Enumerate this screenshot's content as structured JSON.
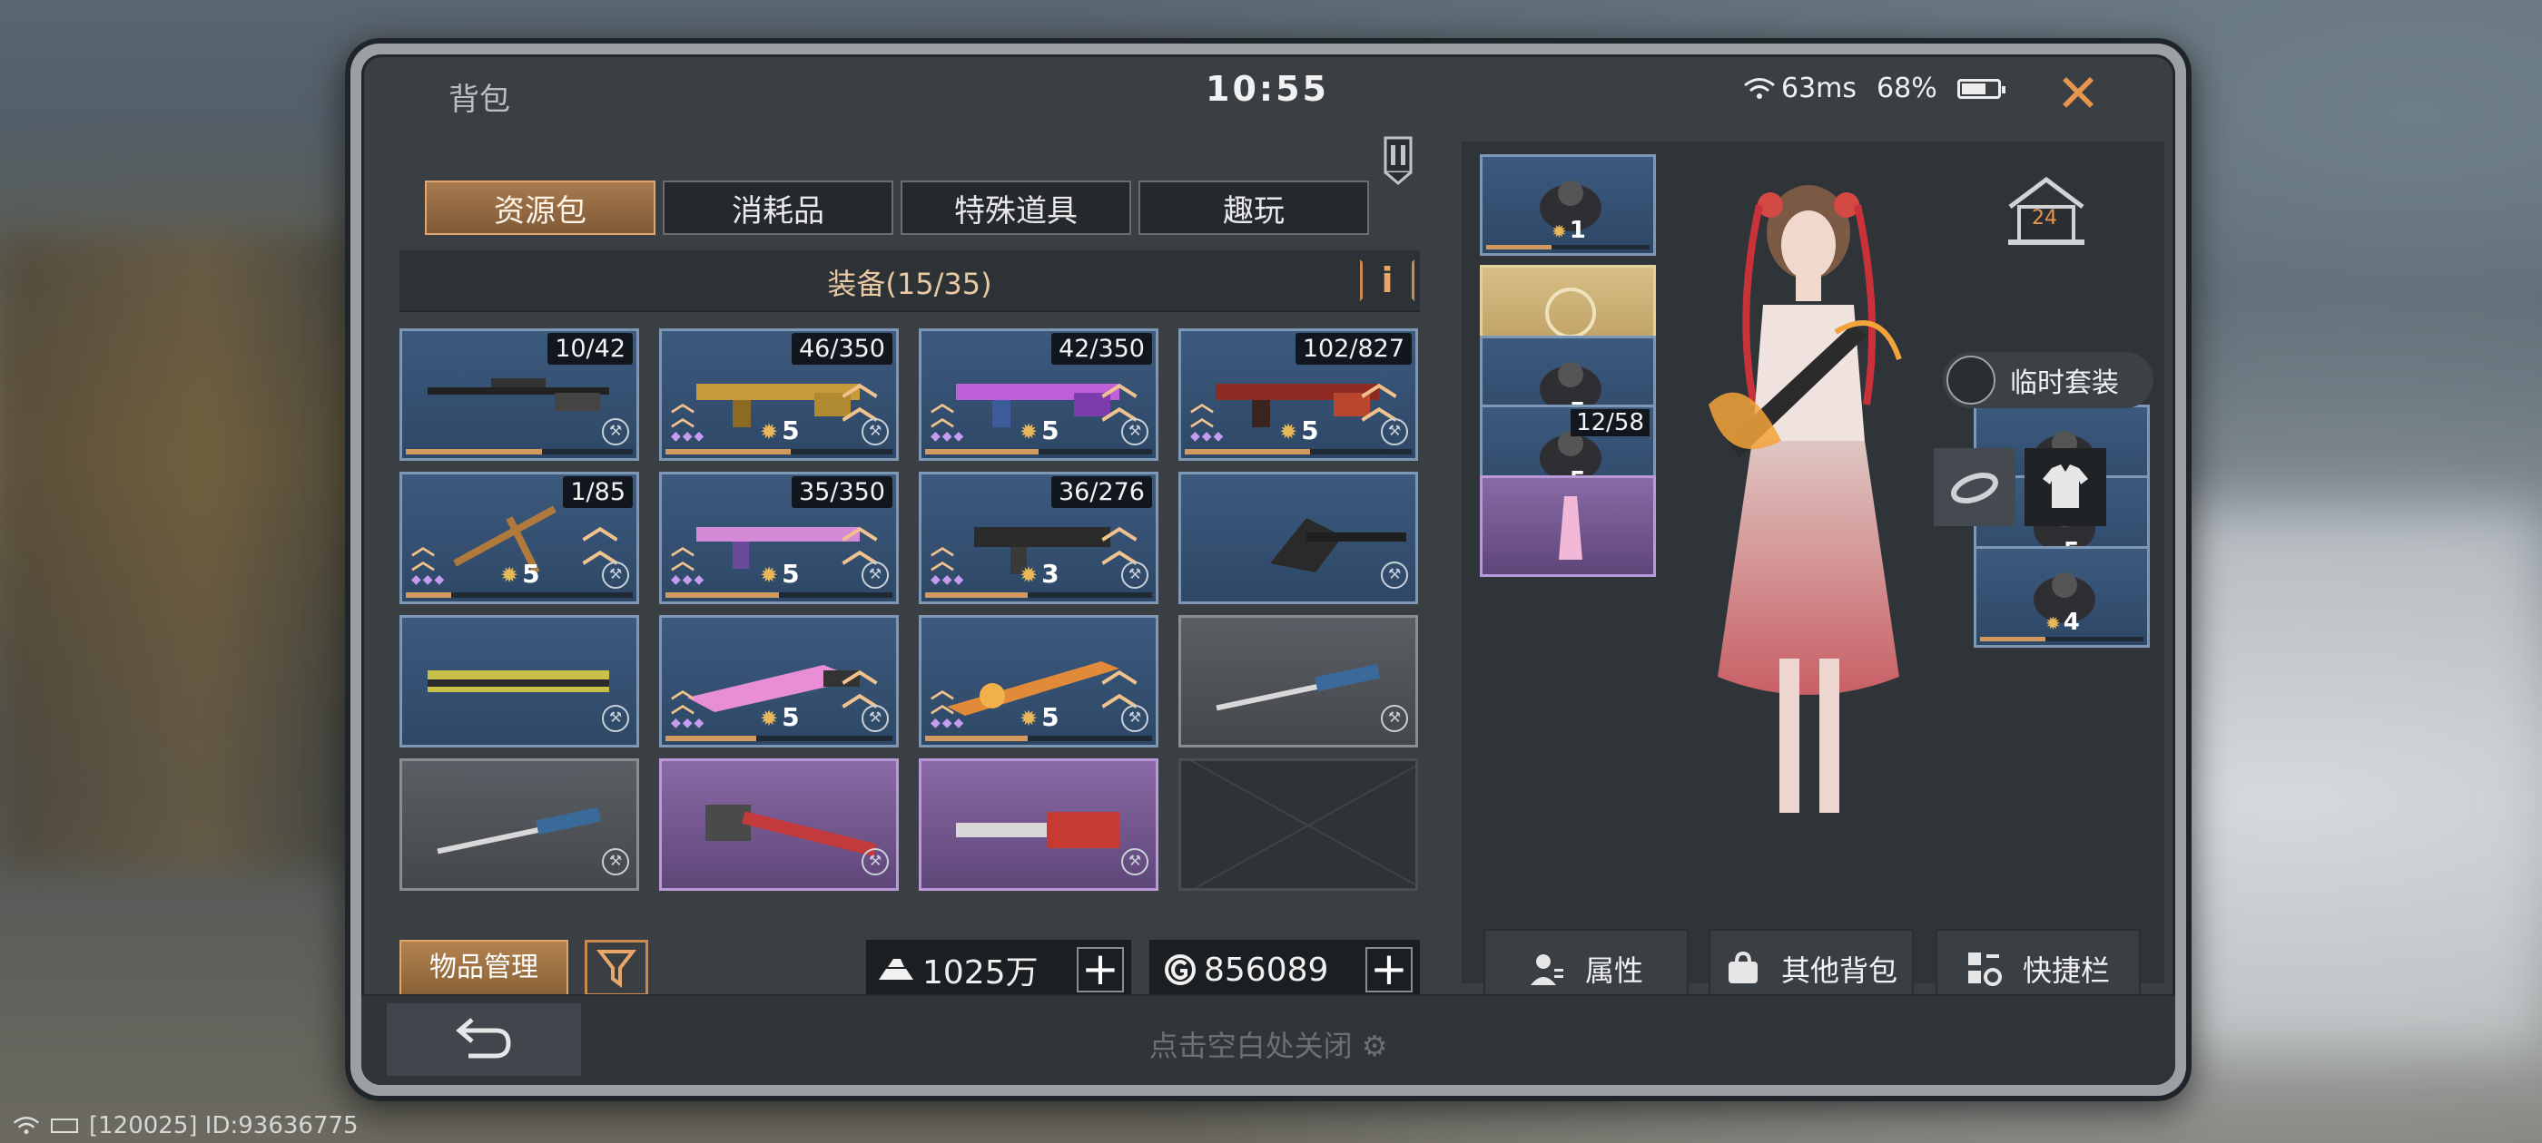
{
  "window": {
    "title": "背包",
    "clock": "10:55"
  },
  "status": {
    "ping": "63ms",
    "battery": "68%",
    "battery_level": 0.68
  },
  "tabs": [
    {
      "label": "资源包",
      "active": true
    },
    {
      "label": "消耗品",
      "active": false
    },
    {
      "label": "特殊道具",
      "active": false
    },
    {
      "label": "趣玩",
      "active": false
    }
  ],
  "equipment": {
    "title": "装备(15/35)",
    "info_label": "i",
    "items": [
      {
        "count": "10/42",
        "level": "",
        "style": "blue",
        "weapon": "sniper-rifle",
        "progress": 0.6
      },
      {
        "count": "46/350",
        "level": "5",
        "style": "blue",
        "weapon": "gold-rifle",
        "progress": 0.55
      },
      {
        "count": "42/350",
        "level": "5",
        "style": "blue",
        "weapon": "purple-rifle",
        "progress": 0.5
      },
      {
        "count": "102/827",
        "level": "5",
        "style": "blue",
        "weapon": "red-rifle",
        "progress": 0.55
      },
      {
        "count": "1/85",
        "level": "5",
        "style": "blue",
        "weapon": "crossbow",
        "progress": 0.2
      },
      {
        "count": "35/350",
        "level": "5",
        "style": "blue",
        "weapon": "pink-rifle",
        "progress": 0.5
      },
      {
        "count": "36/276",
        "level": "3",
        "style": "blue",
        "weapon": "smg",
        "progress": 0.45
      },
      {
        "count": "",
        "level": "",
        "style": "blue",
        "weapon": "axe",
        "progress": 0.0
      },
      {
        "count": "",
        "level": "",
        "style": "blue",
        "weapon": "yellow-shotgun",
        "progress": 0.0
      },
      {
        "count": "",
        "level": "5",
        "style": "blue",
        "weapon": "pink-blade",
        "progress": 0.4
      },
      {
        "count": "",
        "level": "5",
        "style": "blue",
        "weapon": "flame-sword",
        "progress": 0.45
      },
      {
        "count": "",
        "level": "",
        "style": "grey",
        "weapon": "screwdriver",
        "progress": 0.0
      },
      {
        "count": "",
        "level": "",
        "style": "grey",
        "weapon": "screwdriver",
        "progress": 0.0
      },
      {
        "count": "",
        "level": "",
        "style": "purple",
        "weapon": "hammer",
        "progress": 0.0
      },
      {
        "count": "",
        "level": "",
        "style": "purple",
        "weapon": "chainsaw",
        "progress": 0.0
      },
      {
        "count": "",
        "level": "",
        "style": "empty",
        "weapon": "",
        "progress": 0.0
      }
    ]
  },
  "bottom": {
    "manage_label": "物品管理",
    "gold_amount": "1025万",
    "coin_amount": "856089"
  },
  "character": {
    "house_level": "24",
    "temp_suit_label": "临时套装",
    "left_slots": [
      {
        "level": "1",
        "count": "",
        "style": "blue"
      },
      {
        "level": "",
        "count": "",
        "style": "gold"
      },
      {
        "level": "5",
        "count": "",
        "style": "blue"
      },
      {
        "level": "5",
        "count": "12/58",
        "style": "blue"
      },
      {
        "level": "",
        "count": "",
        "style": "purple"
      }
    ],
    "right_slots": [
      {
        "level": "",
        "count": "",
        "style": "blue"
      },
      {
        "level": "5",
        "count": "",
        "style": "blue"
      },
      {
        "level": "4",
        "count": "",
        "style": "blue"
      }
    ],
    "actions": [
      "属性",
      "其他背包",
      "快捷栏"
    ]
  },
  "footer": {
    "tap_close": "点击空白处关闭"
  },
  "system": {
    "device_info": "[120025] ID:93636775"
  },
  "colors": {
    "accent": "#e6954e",
    "tab_active": "#a87a4e",
    "slot_blue": "#3c5a7e",
    "slot_purple": "#8a6aa6"
  }
}
